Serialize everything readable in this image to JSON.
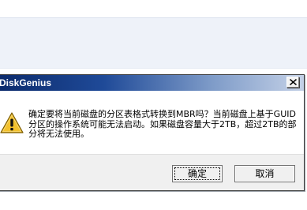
{
  "dialog": {
    "title": "DiskGenius",
    "close_icon": "close-icon",
    "warning_icon": "warning-icon",
    "message": "确定要将当前磁盘的分区表格式转换到MBR吗？当前磁盘上基于GUID分区的操作系统可能无法启动。如果磁盘容量大于2TB，超过2TB的部分将无法使用。",
    "ok_label": "确定",
    "cancel_label": "取消"
  },
  "colors": {
    "titlebar_start": "#0b2a6b",
    "titlebar_end": "#c4d1e7",
    "warning_fill": "#f2c12e",
    "background_band": "#eef2f9",
    "footer": "#f0f0f0"
  }
}
